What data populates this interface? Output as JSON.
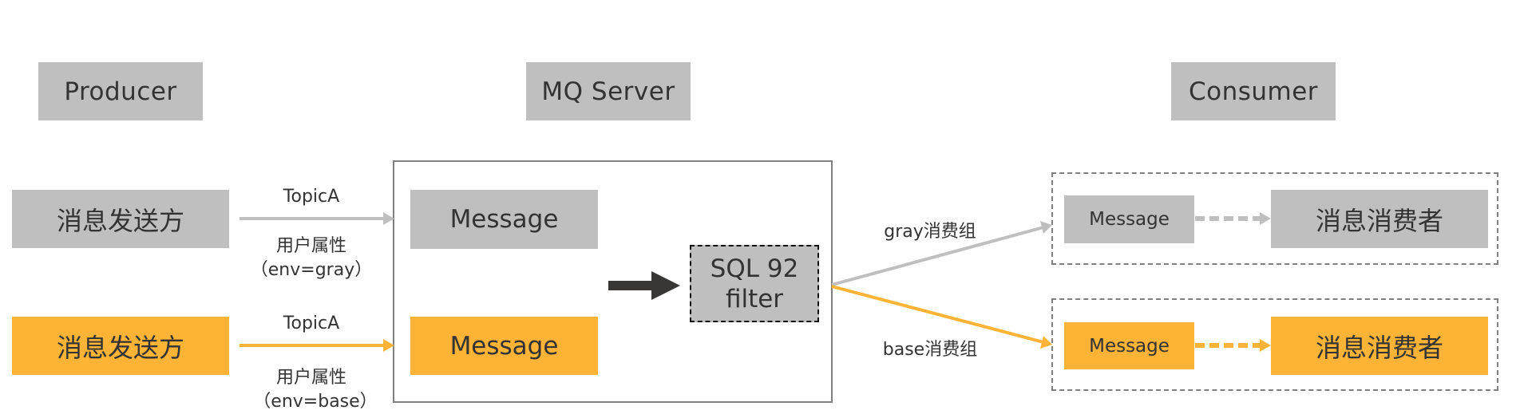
{
  "headers": {
    "producer": "Producer",
    "server": "MQ Server",
    "consumer": "Consumer"
  },
  "producers": [
    {
      "label": "消息发送方",
      "variant": "gray",
      "topic": "TopicA",
      "property_label": "用户属性",
      "property_value": "（env=gray）"
    },
    {
      "label": "消息发送方",
      "variant": "orange",
      "topic": "TopicA",
      "property_label": "用户属性",
      "property_value": "（env=base）"
    }
  ],
  "server": {
    "messages": [
      {
        "label": "Message",
        "variant": "gray"
      },
      {
        "label": "Message",
        "variant": "orange"
      }
    ],
    "filter": {
      "line1": "SQL 92",
      "line2": "filter"
    }
  },
  "consumer_groups": [
    {
      "group_label": "gray消费组",
      "message": "Message",
      "consumer": "消息消费者",
      "variant": "gray"
    },
    {
      "group_label": "base消费组",
      "message": "Message",
      "consumer": "消息消费者",
      "variant": "orange"
    }
  ],
  "colors": {
    "gray": "#bfbfbf",
    "orange": "#fdb336",
    "text": "#333333",
    "frame": "#808080",
    "dark_arrow": "#383735"
  }
}
